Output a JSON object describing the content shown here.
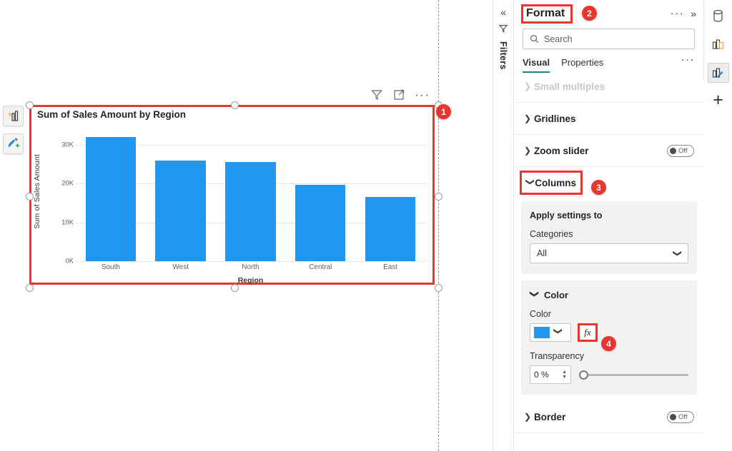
{
  "chart_data": {
    "type": "bar",
    "title": "Sum of Sales Amount by Region",
    "xlabel": "Region",
    "ylabel": "Sum of Sales Amount",
    "categories": [
      "South",
      "West",
      "North",
      "Central",
      "East"
    ],
    "values": [
      32000,
      26000,
      25600,
      19800,
      16600
    ],
    "ylim": [
      0,
      35000
    ],
    "yticks": [
      "0K",
      "10K",
      "20K",
      "30K"
    ],
    "ytick_values": [
      0,
      10000,
      20000,
      30000
    ],
    "grid": true,
    "legend": "none",
    "bar_color": "#1f97f3"
  },
  "canvas": {
    "float_tools": [
      {
        "name": "ai-insights-icon",
        "label": "AI insights"
      },
      {
        "name": "format-brush-icon",
        "label": "Add format"
      }
    ],
    "visual_header": [
      {
        "name": "filter-icon",
        "label": "Filters"
      },
      {
        "name": "focus-mode-icon",
        "label": "Focus mode"
      },
      {
        "name": "more-options-icon",
        "label": "More options"
      }
    ]
  },
  "filters_rail": {
    "collapse_label": "«",
    "title": "Filters"
  },
  "format_pane": {
    "title": "Format",
    "header_more": "···",
    "header_expand": "»",
    "search": {
      "placeholder": "Search",
      "value": ""
    },
    "tabs": [
      {
        "label": "Visual",
        "active": true
      },
      {
        "label": "Properties",
        "active": false
      }
    ],
    "tabs_more": "···",
    "sections": [
      {
        "label": "Small multiples",
        "expanded": false,
        "faded": true
      },
      {
        "label": "Gridlines",
        "expanded": false,
        "toggle": null
      },
      {
        "label": "Zoom slider",
        "expanded": false,
        "toggle": "Off"
      },
      {
        "label": "Columns",
        "expanded": true,
        "highlighted": true
      },
      {
        "label": "Border",
        "expanded": false,
        "toggle": "Off"
      }
    ],
    "columns": {
      "apply_settings_to": "Apply settings to",
      "categories_label": "Categories",
      "categories_value": "All",
      "categories_options": [
        "All"
      ],
      "color_section": {
        "label": "Color",
        "color_field_label": "Color",
        "color_value": "#1f97f3",
        "fx_label": "fx",
        "transparency_label": "Transparency",
        "transparency_value": "0 %"
      }
    }
  },
  "icon_rail": [
    {
      "name": "data-icon",
      "label": "Data"
    },
    {
      "name": "build-visual-icon",
      "label": "Build visual"
    },
    {
      "name": "format-visual-icon",
      "label": "Format visual",
      "selected": true
    },
    {
      "name": "add-icon",
      "label": "Add"
    }
  ],
  "markers": [
    {
      "num": "1"
    },
    {
      "num": "2"
    },
    {
      "num": "3"
    },
    {
      "num": "4"
    }
  ]
}
